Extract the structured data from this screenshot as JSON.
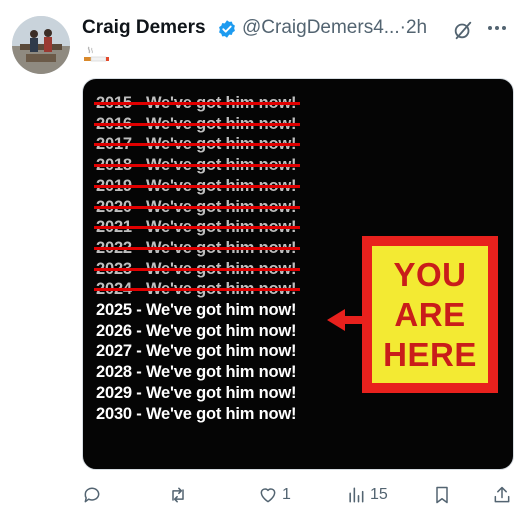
{
  "tweet": {
    "author_name": "Craig Demers",
    "handle": "@CraigDemers4...",
    "separator": "·",
    "time": "2h",
    "text_emoji": "🚬"
  },
  "image": {
    "past_lines": [
      "2015 - We've got him now!",
      "2016 - We've got him now!",
      "2017 - We've got him now!",
      "2018 - We've got him now!",
      "2019 - We've got him now!",
      "2020 - We've got him now!",
      "2021 - We've got him now!",
      "2022 - We've got him now!",
      "2023 - We've got him now!",
      "2024 - We've got him now!"
    ],
    "future_lines": [
      "2025 - We've got him now!",
      "2026 - We've got him now!",
      "2027 - We've got him now!",
      "2028 - We've got him now!",
      "2029 - We've got him now!",
      "2030 - We've got him now!"
    ],
    "sign": {
      "line1": "YOU",
      "line2": "ARE",
      "line3": "HERE"
    }
  },
  "actions": {
    "reply_count": "",
    "retweet_count": "",
    "like_count": "1",
    "views_count": "15"
  },
  "colors": {
    "strike": "#e00000",
    "sign_border": "#e8211d",
    "sign_fill": "#f3ea33",
    "sign_text": "#c91d1a",
    "verified": "#1d9bf0",
    "muted": "#536471"
  },
  "icons": [
    "verified-badge-icon",
    "grok-icon",
    "more-icon",
    "reply-icon",
    "retweet-icon",
    "like-icon",
    "views-icon",
    "bookmark-icon",
    "share-icon"
  ]
}
